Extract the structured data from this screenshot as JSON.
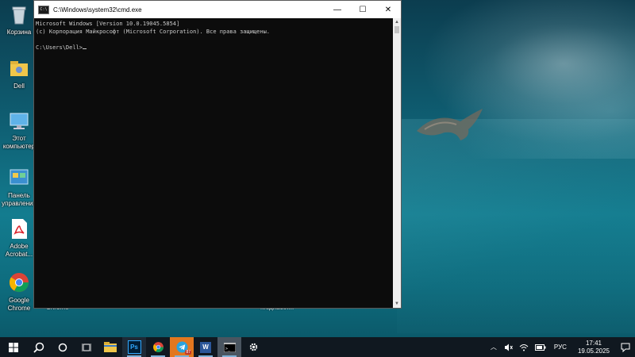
{
  "desktop": {
    "icons": [
      {
        "label": "Корзина",
        "icon": "recycle-bin-icon"
      },
      {
        "label": "Dell",
        "icon": "user-folder-icon"
      },
      {
        "label": "Этот компьютер",
        "icon": "this-pc-icon"
      },
      {
        "label": "Панель управления",
        "icon": "control-panel-icon"
      },
      {
        "label": "Adobe Acrobat...",
        "icon": "adobe-acrobat-icon"
      },
      {
        "label": "Google Chrome",
        "icon": "chrome-icon"
      }
    ],
    "hidden_captions": [
      "Chrome",
      "Медиасет..."
    ]
  },
  "cmd_window": {
    "title": "C:\\Windows\\system32\\cmd.exe",
    "lines": [
      "Microsoft Windows [Version 10.0.19045.5854]",
      "(c) Корпорация Майкрософт (Microsoft Corporation). Все права защищены.",
      "",
      "C:\\Users\\Dell>"
    ],
    "controls": {
      "minimize": "—",
      "maximize": "☐",
      "close": "✕"
    },
    "colors": {
      "background": "#0c0c0c",
      "text": "#cccccc"
    }
  },
  "taskbar": {
    "apps": [
      {
        "name": "start",
        "icon": "windows-start-icon"
      },
      {
        "name": "search",
        "icon": "search-icon"
      },
      {
        "name": "cortana",
        "icon": "cortana-circle-icon"
      },
      {
        "name": "task-view",
        "icon": "task-view-icon"
      },
      {
        "name": "file-explorer",
        "icon": "folder-icon"
      },
      {
        "name": "photoshop",
        "icon": "photoshop-icon",
        "text": "Ps"
      },
      {
        "name": "chrome",
        "icon": "chrome-icon"
      },
      {
        "name": "telegram",
        "icon": "telegram-icon",
        "badge": "87"
      },
      {
        "name": "word",
        "icon": "word-icon",
        "text": "W"
      },
      {
        "name": "cmd",
        "icon": "cmd-icon"
      },
      {
        "name": "settings",
        "icon": "gear-icon"
      }
    ],
    "tray": {
      "language": "РУС",
      "time": "17:41",
      "date": "19.05.2025"
    }
  }
}
